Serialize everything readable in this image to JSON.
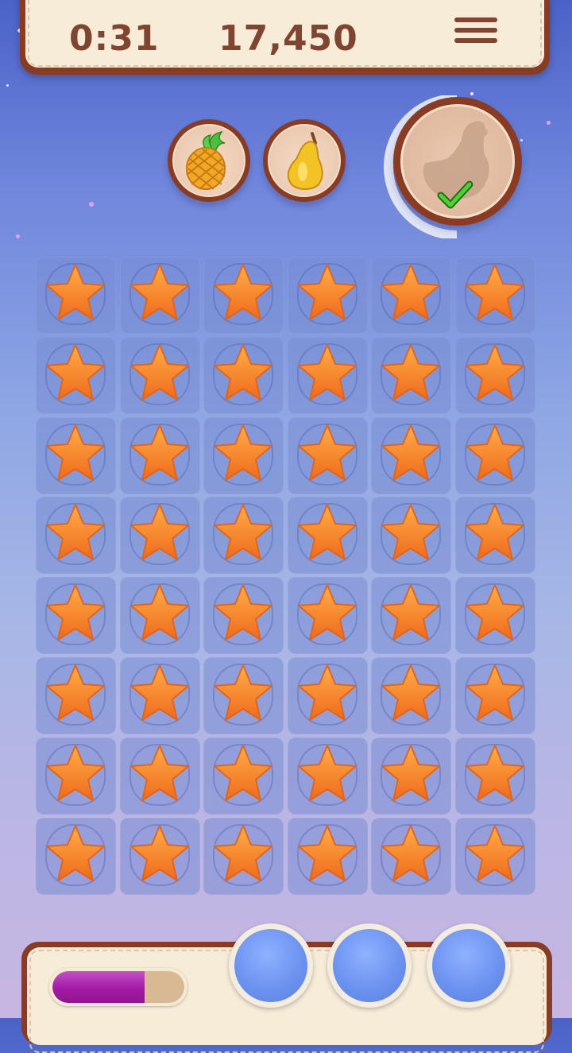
{
  "hud": {
    "timer": "0:31",
    "score": "17,450",
    "menu_icon": "hamburger-menu-icon"
  },
  "goals": [
    {
      "name": "pineapple",
      "icon": "pineapple-icon"
    },
    {
      "name": "pear",
      "icon": "pear-icon"
    },
    {
      "name": "chicken",
      "icon": "chicken-silhouette-icon",
      "completed": true
    }
  ],
  "board": {
    "rows": 8,
    "cols": 6,
    "tile_icon": "orange-star-icon"
  },
  "bottom": {
    "progress_fraction": 0.7,
    "slots": 3
  },
  "colors": {
    "hud_border": "#8a3b23",
    "hud_fill": "#f7ecd8",
    "text": "#7f4530",
    "star": "#f28a2b",
    "progress": "#a21aa5",
    "slot_blue": "#6d93f0",
    "check": "#3fae2b"
  }
}
